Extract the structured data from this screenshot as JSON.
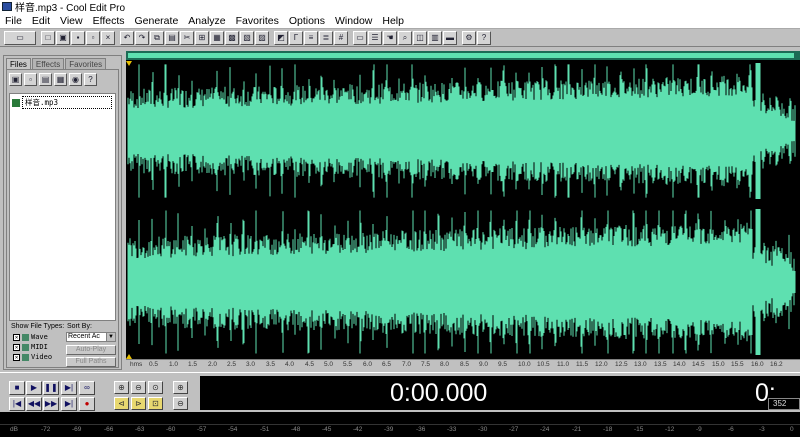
{
  "window": {
    "title": "样音.mp3 - Cool Edit Pro"
  },
  "menu": [
    "File",
    "Edit",
    "View",
    "Effects",
    "Generate",
    "Analyze",
    "Favorites",
    "Options",
    "Window",
    "Help"
  ],
  "left_panel": {
    "tabs": [
      "Files",
      "Effects",
      "Favorites"
    ],
    "files": [
      "样音.mp3"
    ],
    "show_file_types_label": "Show File Types:",
    "sort_by_label": "Sort By:",
    "file_types": [
      {
        "label": "Wave",
        "checked": true
      },
      {
        "label": "MIDI",
        "checked": true
      },
      {
        "label": "Video",
        "checked": true
      }
    ],
    "sort_value": "Recent Ac",
    "autoplay_label": "Auto-Play",
    "fullpaths_label": "Full Paths"
  },
  "ruler": {
    "ticks": [
      "hms",
      "0.5",
      "1.0",
      "1.5",
      "2.0",
      "2.5",
      "3.0",
      "3.5",
      "4.0",
      "4.5",
      "5.0",
      "5.5",
      "6.0",
      "6.5",
      "7.0",
      "7.5",
      "8.0",
      "8.5",
      "9.0",
      "9.5",
      "10.0",
      "10.5",
      "11.0",
      "11.5",
      "12.0",
      "12.5",
      "13.0",
      "13.5",
      "14.0",
      "14.5",
      "15.0",
      "15.5",
      "16.0",
      "16.2"
    ]
  },
  "transport": {
    "time": "0:00.000",
    "time_right": "0:",
    "small_value": "352"
  },
  "level_meter": {
    "labels": [
      "dB",
      "-72",
      "-69",
      "-66",
      "-63",
      "-60",
      "-57",
      "-54",
      "-51",
      "-48",
      "-45",
      "-42",
      "-39",
      "-36",
      "-33",
      "-30",
      "-27",
      "-24",
      "-21",
      "-18",
      "-15",
      "-12",
      "-9",
      "-6",
      "-3",
      "0"
    ]
  },
  "colors": {
    "waveform": "#5ee0b0",
    "background": "#000000",
    "overview": "#1c6a55"
  }
}
